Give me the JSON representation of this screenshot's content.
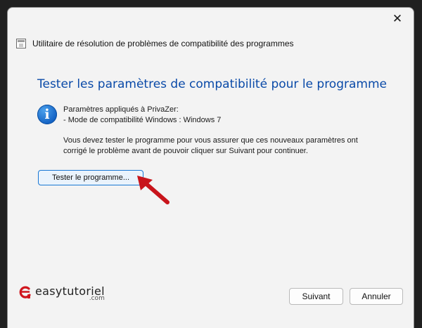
{
  "window": {
    "close_glyph": "✕",
    "title": "Utilitaire de résolution de problèmes de compatibilité des programmes"
  },
  "main": {
    "heading": "Tester les paramètres de compatibilité pour le programme",
    "info_icon_glyph": "i",
    "applied_label": "Paramètres appliqués à PrivaZer:",
    "mode_line": "- Mode de compatibilité Windows : Windows 7",
    "instructions_line1": "Vous devez tester le programme pour vous assurer que ces nouveaux paramètres ont",
    "instructions_line2": "corrigé le problème avant de pouvoir cliquer sur Suivant pour continuer.",
    "test_button_label": "Tester le programme..."
  },
  "footer": {
    "logo_text": "easytutoriel",
    "logo_suffix": ".com",
    "next_label": "Suivant",
    "cancel_label": "Annuler"
  },
  "colors": {
    "heading": "#0a4aa8",
    "primary_border": "#1877d4",
    "arrow": "#c8141b",
    "logo_mark": "#d0161e"
  },
  "icons": [
    "close-icon",
    "app-icon",
    "info-icon",
    "pointer-arrow-icon",
    "easytutoriel-logo-icon"
  ]
}
